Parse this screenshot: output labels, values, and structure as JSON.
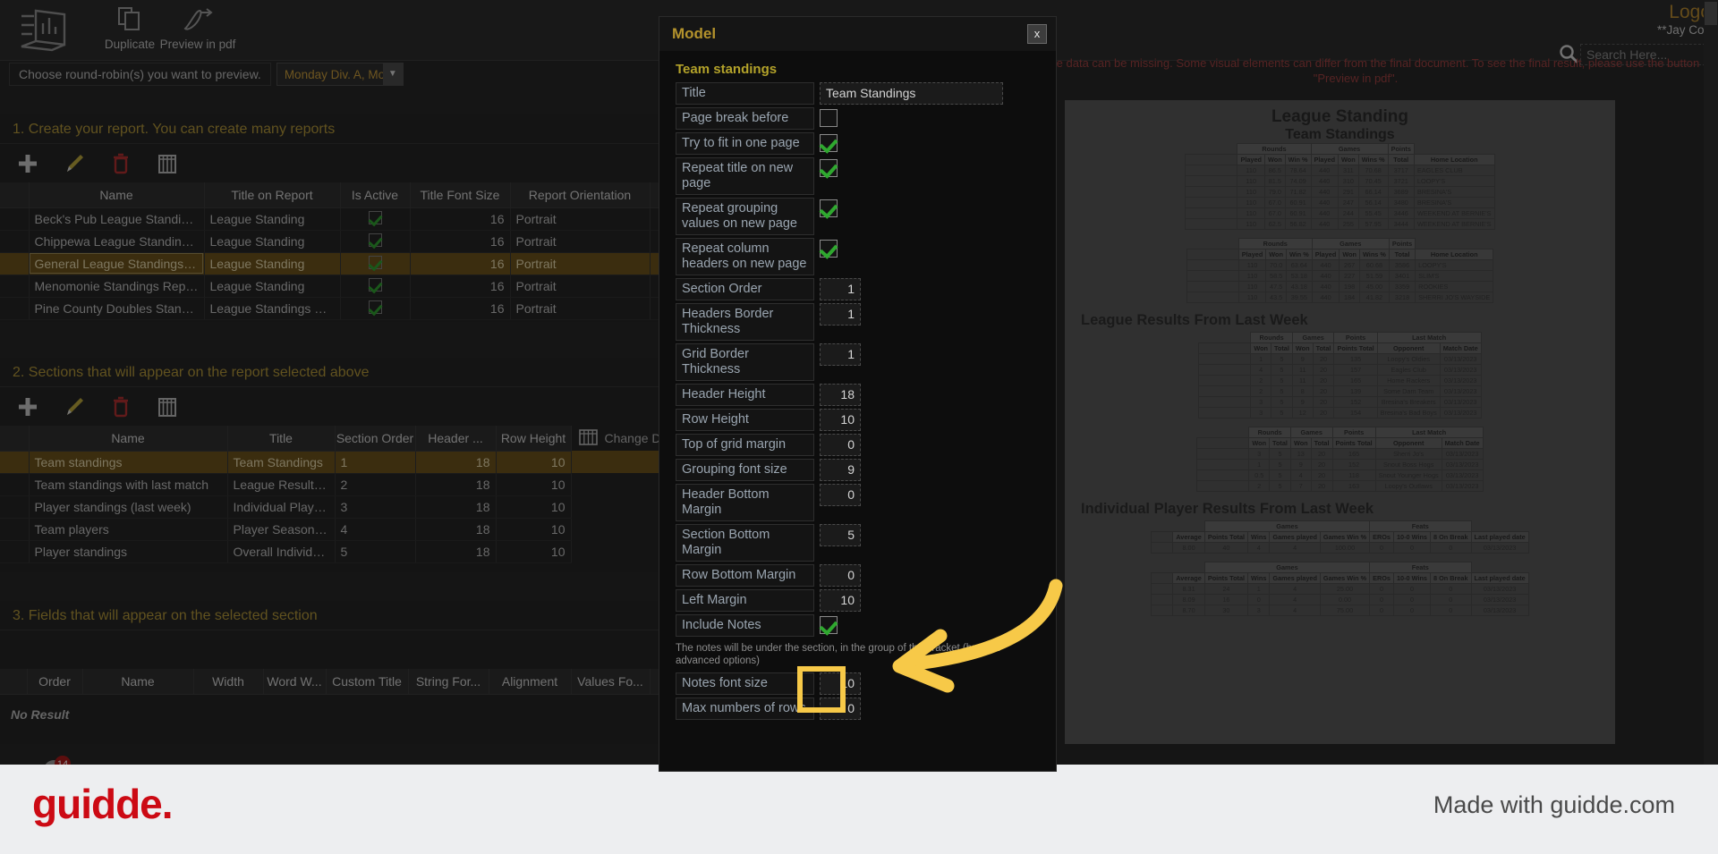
{
  "app": {
    "logo_text": "Logo",
    "user": "**Jay Cou",
    "search_placeholder": "Search Here..."
  },
  "toolbar": {
    "buttons": [
      {
        "label": "Duplicate",
        "icon": "duplicate-icon"
      },
      {
        "label": "Preview in pdf",
        "icon": "pdf-icon"
      }
    ],
    "roundrobin_label": "Choose round-robin(s) you want to preview.",
    "roundrobin_value": "Monday Div. A, Mond..."
  },
  "warning": "and some data can be missing. Some visual elements can differ from the final document. To see the final result, please use the button \"Preview in pdf\".",
  "section1": {
    "title": "1. Create your report. You can create many reports",
    "icons": [
      "add-icon",
      "edit-icon",
      "delete-icon",
      "columns-icon"
    ],
    "columns": [
      "",
      "Name",
      "Title on Report",
      "Is Active",
      "Title Font Size",
      "Report Orientation"
    ],
    "rows": [
      {
        "name": "Beck's Pub League Standing...",
        "title": "League Standing",
        "active": true,
        "font_size": "16",
        "orientation": "Portrait",
        "selected": false
      },
      {
        "name": "Chippewa League Standing ...",
        "title": "League Standing",
        "active": true,
        "font_size": "16",
        "orientation": "Portrait",
        "selected": false
      },
      {
        "name": "General League Standings Repo",
        "title": "League Standing",
        "active": true,
        "font_size": "16",
        "orientation": "Portrait",
        "selected": true
      },
      {
        "name": "Menomonie Standings Report",
        "title": "League Standing",
        "active": true,
        "font_size": "16",
        "orientation": "Portrait",
        "selected": false
      },
      {
        "name": "Pine County Doubles Standi...",
        "title": "League Standings Re...",
        "active": true,
        "font_size": "16",
        "orientation": "Portrait",
        "selected": false
      }
    ]
  },
  "section2": {
    "title": "2. Sections that will appear on the report selected above",
    "icons": [
      "add-icon",
      "edit-icon",
      "delete-icon",
      "columns-icon"
    ],
    "columns": [
      "",
      "Name",
      "Title",
      "Section Order",
      "Header ...",
      "Row Height"
    ],
    "change_display": "Change Di",
    "rows": [
      {
        "name": "Team standings",
        "title": "Team Standings",
        "order": "1",
        "header": "18",
        "row_height": "10",
        "selected": true
      },
      {
        "name": "Team standings with last match",
        "title": "League Results ...",
        "order": "2",
        "header": "18",
        "row_height": "10",
        "selected": false
      },
      {
        "name": "Player standings (last week)",
        "title": "Individual Playe...",
        "order": "3",
        "header": "18",
        "row_height": "10",
        "selected": false
      },
      {
        "name": "Team players",
        "title": "Player Season T...",
        "order": "4",
        "header": "18",
        "row_height": "10",
        "selected": false
      },
      {
        "name": "Player standings",
        "title": "Overall Individu...",
        "order": "5",
        "header": "18",
        "row_height": "10",
        "selected": false
      }
    ]
  },
  "section3": {
    "title": "3. Fields that will appear on the selected section",
    "columns": [
      "",
      "Order",
      "Name",
      "Width",
      "Word W...",
      "Custom Title",
      "String For...",
      "Alignment",
      "Values Fo..."
    ],
    "empty_text": "No Result"
  },
  "modal": {
    "title": "Model",
    "close_label": "x",
    "group_title": "Team standings",
    "fields": [
      {
        "label": "Title",
        "type": "text",
        "value": "Team Standings"
      },
      {
        "label": "Page break before",
        "type": "check",
        "checked": false
      },
      {
        "label": "Try to fit in one page",
        "type": "check",
        "checked": true
      },
      {
        "label": "Repeat title on new page",
        "type": "check",
        "checked": true
      },
      {
        "label": "Repeat grouping values on new page",
        "type": "check",
        "checked": true
      },
      {
        "label": "Repeat column headers on new page",
        "type": "check",
        "checked": true
      },
      {
        "label": "Section Order",
        "type": "num",
        "value": "1"
      },
      {
        "label": "Headers Border Thickness",
        "type": "num",
        "value": "1"
      },
      {
        "label": "Grid Border Thickness",
        "type": "num",
        "value": "1"
      },
      {
        "label": "Header Height",
        "type": "num",
        "value": "18"
      },
      {
        "label": "Row Height",
        "type": "num",
        "value": "10"
      },
      {
        "label": "Top of grid margin",
        "type": "num",
        "value": "0"
      },
      {
        "label": "Grouping font size",
        "type": "num",
        "value": "9"
      },
      {
        "label": "Header Bottom Margin",
        "type": "num",
        "value": "0"
      },
      {
        "label": "Section Bottom Margin",
        "type": "num",
        "value": "5"
      },
      {
        "label": "Row Bottom Margin",
        "type": "num",
        "value": "0"
      },
      {
        "label": "Left Margin",
        "type": "num",
        "value": "10"
      },
      {
        "label": "Include Notes",
        "type": "check",
        "checked": true
      },
      {
        "label": "Notes font size",
        "type": "num",
        "value": "10"
      },
      {
        "label": "Max numbers of rows",
        "type": "num",
        "value": "0"
      }
    ],
    "notes_hint": "The notes will be under the section, in the group of the bracket (bracket advanced options)"
  },
  "preview": {
    "doc_title": "League Standing",
    "doc_subtitle": "Team Standings",
    "standings_group_headers": [
      "Rounds",
      "Games",
      "Points"
    ],
    "standings_headers": [
      "Played",
      "Won",
      "Win %",
      "Played",
      "Won",
      "Wins %",
      "Total",
      "Home Location"
    ],
    "standings_block1": [
      [
        "110",
        "86.5",
        "78.64",
        "440",
        "311",
        "70.68",
        "3717",
        "EAGLES CLUB"
      ],
      [
        "110",
        "81.5",
        "74.09",
        "440",
        "310",
        "70.45",
        "3721",
        "LOOPY'S"
      ],
      [
        "110",
        "79.0",
        "71.82",
        "440",
        "291",
        "66.14",
        "3689",
        "BRESINA'S"
      ],
      [
        "110",
        "67.0",
        "60.91",
        "440",
        "247",
        "56.14",
        "3480",
        "BRESINA'S"
      ],
      [
        "110",
        "67.0",
        "60.91",
        "440",
        "244",
        "55.45",
        "3446",
        "WEEKEND AT BERNIE'S"
      ],
      [
        "110",
        "62.5",
        "56.82",
        "440",
        "255",
        "57.95",
        "3444",
        "WEEKEND AT BERNIE'S"
      ]
    ],
    "standings_block2": [
      [
        "110",
        "70.0",
        "63.64",
        "440",
        "267",
        "60.68",
        "3586",
        "LOOPY'S"
      ],
      [
        "110",
        "58.5",
        "53.18",
        "440",
        "227",
        "51.59",
        "3401",
        "SLIM'S"
      ],
      [
        "110",
        "47.5",
        "43.18",
        "440",
        "198",
        "45.00",
        "3359",
        "ROOKIES"
      ],
      [
        "110",
        "43.5",
        "39.55",
        "440",
        "184",
        "41.82",
        "3218",
        "SHERRI JO'S WAYSIDE"
      ]
    ],
    "results_title": "League Results From Last Week",
    "results_group_headers": [
      "Rounds",
      "Games",
      "Points",
      "Last Match"
    ],
    "results_headers": [
      "Won",
      "Total",
      "Won",
      "Total",
      "Points Total",
      "Opponent",
      "Match Date"
    ],
    "results_block1": [
      [
        "1",
        "5",
        "9",
        "20",
        "135",
        "Loopy's Oldies",
        "03/13/2023"
      ],
      [
        "4",
        "5",
        "11",
        "20",
        "157",
        "Eagles Club",
        "03/13/2023"
      ],
      [
        "2",
        "5",
        "11",
        "20",
        "165",
        "Home Rackers",
        "03/13/2023"
      ],
      [
        "2",
        "5",
        "8",
        "20",
        "139",
        "Some Dam Team",
        "03/13/2023"
      ],
      [
        "3",
        "5",
        "9",
        "20",
        "152",
        "Bresina's Breakers",
        "03/13/2023"
      ],
      [
        "3",
        "5",
        "12",
        "20",
        "154",
        "Bresina's Bad Boys",
        "03/13/2023"
      ]
    ],
    "results_block2": [
      [
        "3",
        "5",
        "13",
        "20",
        "165",
        "Sherri Jo's",
        "03/13/2023"
      ],
      [
        "1",
        "5",
        "9",
        "20",
        "152",
        "Snout Boss Hogs",
        "03/13/2023"
      ],
      [
        "0.5",
        "5",
        "4",
        "20",
        "118",
        "Snout Younger Hogs",
        "03/13/2023"
      ],
      [
        "2",
        "5",
        "7",
        "20",
        "163",
        "Loopy's Outlaws",
        "03/13/2023"
      ]
    ],
    "player_title": "Individual Player Results From Last Week",
    "player_group_headers": [
      "Games",
      "Feats"
    ],
    "player_headers": [
      "Average",
      "Points Total",
      "Wins",
      "Games played",
      "Games Win %",
      "EROs",
      "10-0 Wins",
      "8 On Break",
      "Last played date"
    ],
    "player_block1": [
      [
        "8.00",
        "40",
        "4",
        "4",
        "100.00",
        "0",
        "0",
        "0",
        "03/13/2023"
      ]
    ],
    "player_block2": [
      [
        "8.31",
        "24",
        "1",
        "4",
        "25.00",
        "0",
        "0",
        "0",
        "03/13/2023"
      ],
      [
        "8.09",
        "16",
        "0",
        "4",
        "0.00",
        "0",
        "0",
        "0",
        "03/13/2023"
      ],
      [
        "8.70",
        "30",
        "3",
        "4",
        "75.00",
        "0",
        "0",
        "0",
        "03/13/2023"
      ]
    ]
  },
  "footer": {
    "brand": "guidde.",
    "made_with": "Made with guidde.com",
    "badge_count": "14"
  },
  "colors": {
    "accent_yellow": "#f7c948",
    "brand_red": "#cc0a14",
    "section_heading": "#b09539",
    "selected_row": "#6b521c"
  }
}
